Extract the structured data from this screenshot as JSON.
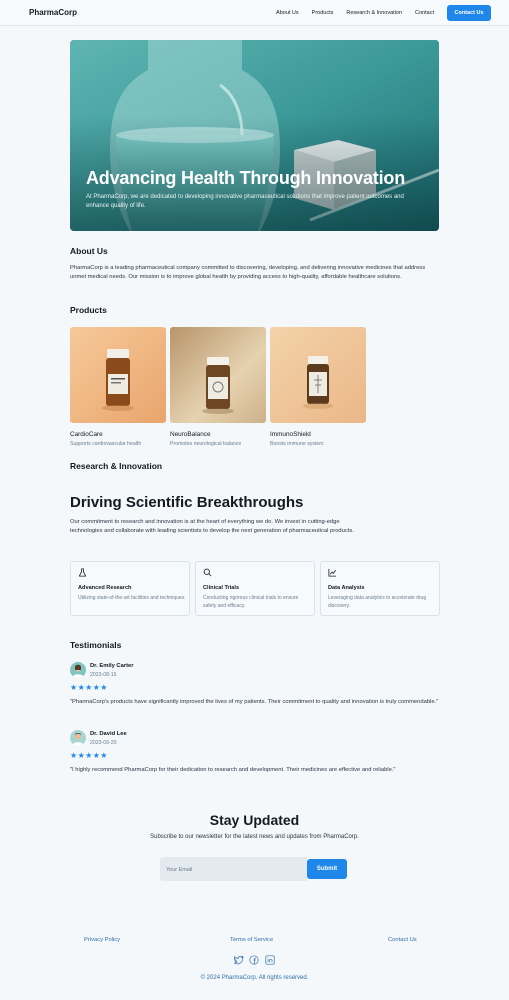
{
  "header": {
    "brand": "PharmaCorp",
    "nav": [
      "About Us",
      "Products",
      "Research & Innovation",
      "Contact"
    ],
    "cta": "Contact Us"
  },
  "hero": {
    "title": "Advancing Health Through Innovation",
    "subtitle": "At PharmaCorp, we are dedicated to developing innovative pharmaceutical solutions that improve patient outcomes and enhance quality of life."
  },
  "about": {
    "heading": "About Us",
    "text": "PharmaCorp is a leading pharmaceutical company committed to discovering, developing, and delivering innovative medicines that address unmet medical needs. Our mission is to improve global health by providing access to high-quality, affordable healthcare solutions."
  },
  "products": {
    "heading": "Products",
    "items": [
      {
        "name": "CardioCare",
        "desc": "Supports cardiovascular health"
      },
      {
        "name": "NeuroBalance",
        "desc": "Promotes neurological balance"
      },
      {
        "name": "ImmunoShield",
        "desc": "Boosts immune system"
      }
    ]
  },
  "research": {
    "heading": "Research & Innovation",
    "title": "Driving Scientific Breakthroughs",
    "text": "Our commitment to research and innovation is at the heart of everything we do. We invest in cutting-edge technologies and collaborate with leading scientists to develop the next generation of pharmaceutical products.",
    "cards": [
      {
        "icon": "flask-icon",
        "title": "Advanced Research",
        "desc": "Utilizing state-of-the-art facilities and techniques."
      },
      {
        "icon": "search-icon",
        "title": "Clinical Trials",
        "desc": "Conducting rigorous clinical trials to ensure safety and efficacy."
      },
      {
        "icon": "chart-icon",
        "title": "Data Analysis",
        "desc": "Leveraging data analytics to accelerate drug discovery."
      }
    ]
  },
  "testimonials": {
    "heading": "Testimonials",
    "items": [
      {
        "name": "Dr. Emily Carter",
        "date": "2023-08-15",
        "stars": "★★★★★",
        "rating": 5,
        "quote": "\"PharmaCorp's products have significantly improved the lives of my patients. Their commitment to quality and innovation is truly commendable.\""
      },
      {
        "name": "Dr. David Lee",
        "date": "2023-09-20",
        "stars": "★★★★★",
        "rating": 5,
        "quote": "\"I highly recommend PharmaCorp for their dedication to research and development. Their medicines are effective and reliable.\""
      }
    ]
  },
  "newsletter": {
    "title": "Stay Updated",
    "subtitle": "Subscribe to our newsletter for the latest news and updates from PharmaCorp.",
    "placeholder": "Your Email",
    "button": "Submit"
  },
  "footer": {
    "links": [
      "Privacy Policy",
      "Terms of Service",
      "Contact Us"
    ],
    "social": [
      "twitter-icon",
      "facebook-icon",
      "linkedin-icon"
    ],
    "copyright": "© 2024 PharmaCorp. All rights reserved."
  },
  "colors": {
    "accent": "#1f86ea",
    "hero_teal": "#2f8c8f"
  }
}
